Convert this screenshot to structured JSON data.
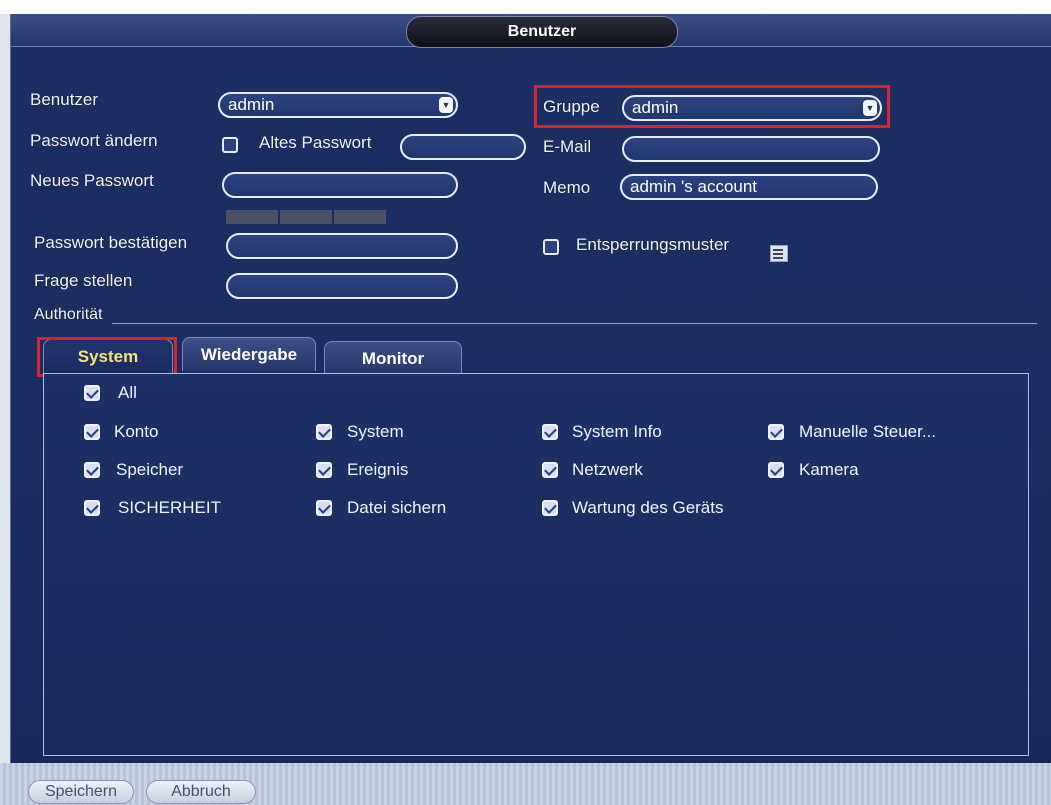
{
  "window": {
    "title": "Benutzer"
  },
  "form": {
    "user_label": "Benutzer",
    "user_value": "admin",
    "change_password_label": "Passwort ändern",
    "old_password_label": "Altes Passwort",
    "new_password_label": "Neues Passwort",
    "confirm_password_label": "Passwort bestätigen",
    "question_label": "Frage stellen",
    "group_label": "Gruppe",
    "group_value": "admin",
    "email_label": "E-Mail",
    "memo_label": "Memo",
    "memo_value": "admin 's account",
    "unlock_pattern_label": "Entsperrungsmuster",
    "authority_label": "Authorität"
  },
  "tabs": [
    {
      "label": "System",
      "active": true
    },
    {
      "label": "Wiedergabe",
      "active": false
    },
    {
      "label": "Monitor",
      "active": false
    }
  ],
  "permissions": {
    "all": "All",
    "items": [
      "Konto",
      "System",
      "System Info",
      "Manuelle Steuer...",
      "Speicher",
      "Ereignis",
      "Netzwerk",
      "Kamera",
      "SICHERHEIT",
      "Datei sichern",
      "Wartung des Geräts"
    ]
  },
  "footer": {
    "save_label": "Speichern",
    "cancel_label": "Abbruch"
  },
  "colors": {
    "highlight": "#e0202c",
    "active_tab_text": "#f5e46b",
    "window_bg": "#1b2f63"
  }
}
